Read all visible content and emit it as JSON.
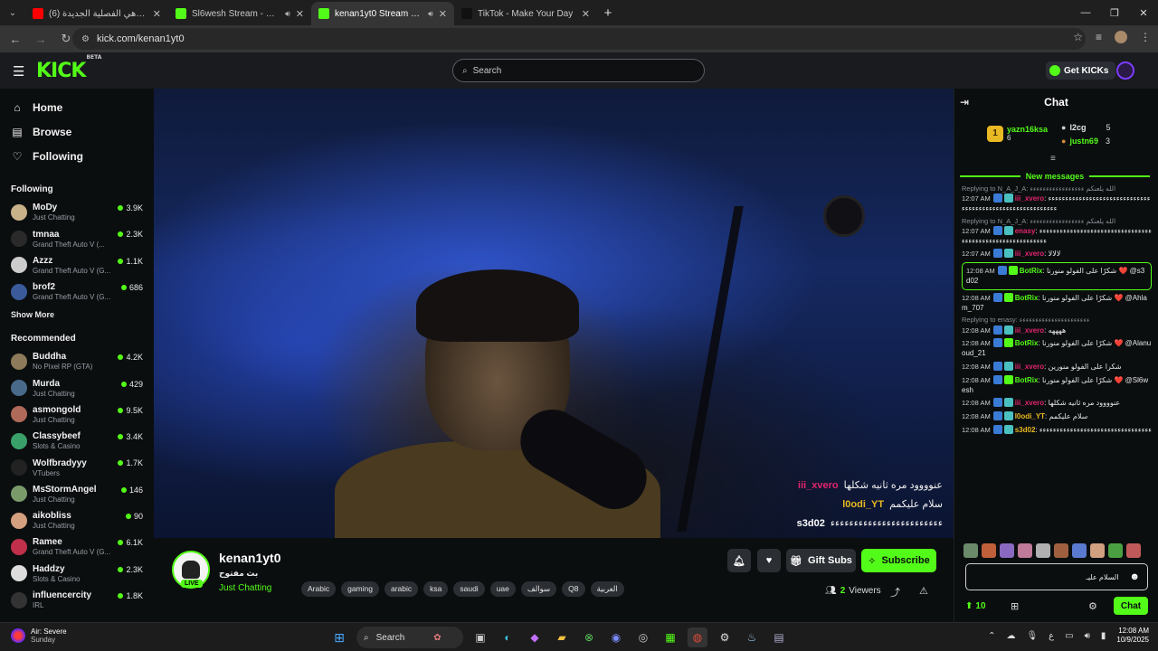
{
  "browser": {
    "tabs": [
      {
        "title": "(6) ملاهي الفصلية الجديدة !!",
        "favicon_color": "#ff0000",
        "active": false,
        "sound": false
      },
      {
        "title": "Sl6wesh Stream - Watch Live",
        "favicon_color": "#53fc18",
        "active": false,
        "sound": true
      },
      {
        "title": "kenan1yt0 Stream - Watch",
        "favicon_color": "#53fc18",
        "active": true,
        "sound": true
      },
      {
        "title": "TikTok - Make Your Day",
        "favicon_color": "#111111",
        "active": false,
        "sound": false
      }
    ],
    "url": "kick.com/kenan1yt0"
  },
  "header": {
    "logo": "KICK",
    "logo_sup": "BETA",
    "search_placeholder": "Search",
    "get_kicks": "Get KICKs"
  },
  "sidebar": {
    "nav": [
      {
        "label": "Home",
        "icon": "home-icon"
      },
      {
        "label": "Browse",
        "icon": "browse-icon"
      },
      {
        "label": "Following",
        "icon": "heart-icon"
      }
    ],
    "following_title": "Following",
    "following": [
      {
        "name": "MoDy",
        "category": "Just Chatting",
        "viewers": "3.9K",
        "color": "#c9b28a"
      },
      {
        "name": "tmnaa",
        "category": "Grand Theft Auto V (...",
        "viewers": "2.3K",
        "color": "#2a2a2a"
      },
      {
        "name": "Azzz",
        "category": "Grand Theft Auto V (G...",
        "viewers": "1.1K",
        "color": "#cccccc"
      },
      {
        "name": "brof2",
        "category": "Grand Theft Auto V (G...",
        "viewers": "686",
        "color": "#3a5a9a"
      }
    ],
    "show_more": "Show More",
    "recommended_title": "Recommended",
    "recommended": [
      {
        "name": "Buddha",
        "category": "No Pixel RP (GTA)",
        "viewers": "4.2K",
        "color": "#8c7a5a"
      },
      {
        "name": "Murda",
        "category": "Just Chatting",
        "viewers": "429",
        "color": "#4a6a8a"
      },
      {
        "name": "asmongold",
        "category": "Just Chatting",
        "viewers": "9.5K",
        "color": "#b06a5a"
      },
      {
        "name": "Classybeef",
        "category": "Slots & Casino",
        "viewers": "3.4K",
        "color": "#3aa06a"
      },
      {
        "name": "Wolfbradyyy",
        "category": "VTubers",
        "viewers": "1.7K",
        "color": "#222222"
      },
      {
        "name": "MsStormAngel",
        "category": "Just Chatting",
        "viewers": "146",
        "color": "#7a9a6a"
      },
      {
        "name": "aikobliss",
        "category": "Just Chatting",
        "viewers": "90",
        "color": "#d4a080"
      },
      {
        "name": "Ramee",
        "category": "Grand Theft Auto V (G...",
        "viewers": "6.1K",
        "color": "#c0304a"
      },
      {
        "name": "Haddzy",
        "category": "Slots & Casino",
        "viewers": "2.3K",
        "color": "#dddddd"
      },
      {
        "name": "influencercity",
        "category": "IRL",
        "viewers": "1.8K",
        "color": "#333333"
      }
    ]
  },
  "video_overlay": [
    {
      "user": "iii_xvero",
      "msg": "عنوووود مره ثانيه شكلها",
      "color": "#e0246e"
    },
    {
      "user": "l0odi_YT",
      "msg": "سلام عليكمم",
      "color": "#e8b923"
    },
    {
      "user": "s3d02",
      "msg": "ءءءءءءءءءءءءءءءءءءءءءءءء",
      "color": "#ffffff"
    }
  ],
  "stream": {
    "streamer": "kenan1yt0",
    "title": "بث مفتوح",
    "category": "Just Chatting",
    "live": "LIVE",
    "tags": [
      "Arabic",
      "gaming",
      "arabic",
      "ksa",
      "saudi",
      "uae",
      "سوالف",
      "Q8",
      "العربية"
    ],
    "gift_subs": "Gift Subs",
    "subscribe": "Subscribe",
    "viewers_count": "2",
    "viewers_label": "Viewers"
  },
  "chat": {
    "title": "Chat",
    "leaderboard": {
      "top_name": "yazn16ksa",
      "top_count": "6",
      "second_name": "l2cg",
      "second_count": "5",
      "third_name": "justn69",
      "third_count": "3"
    },
    "new_messages": "New messages",
    "messages": [
      {
        "reply": "Replying to N_A_J_A: الله يلعنكم ءءءءءءءءءءءءءءءءء",
        "time": "12:07 AM",
        "user": "iii_xvero",
        "color": "#e0246e",
        "text": "ءءءءءءءءءءءءءءءءءءءءءءءءءءءءءءءءءءءءءءءءءءءءءءءءءءءءءءءءءء",
        "highlight": false
      },
      {
        "reply": "Replying to N_A_J_A: الله يلعنكم ءءءءءءءءءءءءءءءءء",
        "time": "12:07 AM",
        "user": "enasy",
        "color": "#e0246e",
        "text": "ءءءءءءءءءءءءءءءءءءءءءءءءءءءءءءءءءءءءءءءءءءءءءءءءءءءءءءءءءء",
        "highlight": false
      },
      {
        "reply": "",
        "time": "12:07 AM",
        "user": "iii_xvero",
        "color": "#e0246e",
        "text": "لالالا",
        "highlight": false
      },
      {
        "reply": "",
        "time": "12:08 AM",
        "user": "BotRix",
        "color": "#53fc18",
        "text": "شكرًا على الفولو منورنا ❤️ @s3d02",
        "highlight": true
      },
      {
        "reply": "",
        "time": "12:08 AM",
        "user": "BotRix",
        "color": "#53fc18",
        "text": "شكرًا على الفولو منورنا ❤️ @Ahlam_707",
        "highlight": false
      },
      {
        "reply": "Replying to enasy: ءءءءءءءءءءءءءءءءءءءءءء",
        "time": "12:08 AM",
        "user": "iii_xvero",
        "color": "#e0246e",
        "text": "ههههه",
        "highlight": false
      },
      {
        "reply": "",
        "time": "12:08 AM",
        "user": "BotRix",
        "color": "#53fc18",
        "text": "شكرًا على الفولو منورنا ❤️ @Alanuoud_21",
        "highlight": false
      },
      {
        "reply": "",
        "time": "12:08 AM",
        "user": "iii_xvero",
        "color": "#e0246e",
        "text": "شكرا على الفولو منورين",
        "highlight": false
      },
      {
        "reply": "",
        "time": "12:08 AM",
        "user": "BotRix",
        "color": "#53fc18",
        "text": "شكرًا على الفولو منورنا ❤️ @Sl6wesh",
        "highlight": false
      },
      {
        "reply": "",
        "time": "12:08 AM",
        "user": "iii_xvero",
        "color": "#e0246e",
        "text": "عنوووود مره ثانيه شكلها",
        "highlight": false
      },
      {
        "reply": "",
        "time": "12:08 AM",
        "user": "l0odi_YT",
        "color": "#e8b923",
        "text": "سلام عليكمم",
        "highlight": false
      },
      {
        "reply": "",
        "time": "12:08 AM",
        "user": "s3d02",
        "color": "#e8b923",
        "text": "ءءءءءءءءءءءءءءءءءءءءءءءءءءءءءءءءء",
        "highlight": false
      }
    ],
    "input_value": "السلام عليـ",
    "points": "10",
    "send_label": "Chat"
  },
  "taskbar": {
    "weather_title": "Air: Severe",
    "weather_sub": "Sunday",
    "search": "Search",
    "time": "12:08 AM",
    "date": "10/9/2025",
    "lang": "ع"
  }
}
